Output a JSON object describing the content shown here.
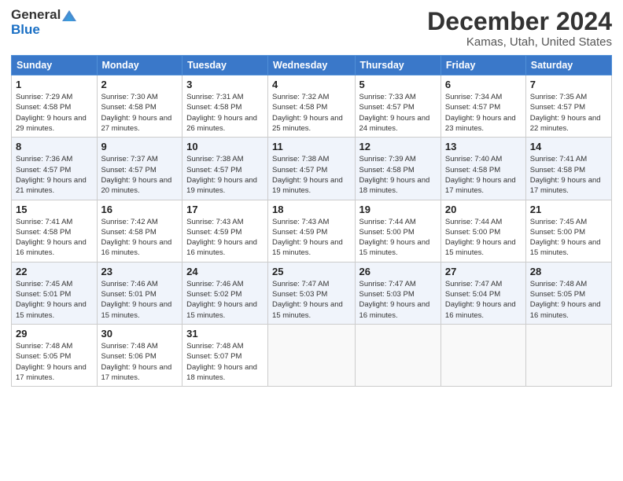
{
  "logo": {
    "general": "General",
    "blue": "Blue"
  },
  "title": "December 2024",
  "location": "Kamas, Utah, United States",
  "days_header": [
    "Sunday",
    "Monday",
    "Tuesday",
    "Wednesday",
    "Thursday",
    "Friday",
    "Saturday"
  ],
  "weeks": [
    [
      {
        "day": "1",
        "sunrise": "7:29 AM",
        "sunset": "4:58 PM",
        "daylight": "9 hours and 29 minutes."
      },
      {
        "day": "2",
        "sunrise": "7:30 AM",
        "sunset": "4:58 PM",
        "daylight": "9 hours and 27 minutes."
      },
      {
        "day": "3",
        "sunrise": "7:31 AM",
        "sunset": "4:58 PM",
        "daylight": "9 hours and 26 minutes."
      },
      {
        "day": "4",
        "sunrise": "7:32 AM",
        "sunset": "4:58 PM",
        "daylight": "9 hours and 25 minutes."
      },
      {
        "day": "5",
        "sunrise": "7:33 AM",
        "sunset": "4:57 PM",
        "daylight": "9 hours and 24 minutes."
      },
      {
        "day": "6",
        "sunrise": "7:34 AM",
        "sunset": "4:57 PM",
        "daylight": "9 hours and 23 minutes."
      },
      {
        "day": "7",
        "sunrise": "7:35 AM",
        "sunset": "4:57 PM",
        "daylight": "9 hours and 22 minutes."
      }
    ],
    [
      {
        "day": "8",
        "sunrise": "7:36 AM",
        "sunset": "4:57 PM",
        "daylight": "9 hours and 21 minutes."
      },
      {
        "day": "9",
        "sunrise": "7:37 AM",
        "sunset": "4:57 PM",
        "daylight": "9 hours and 20 minutes."
      },
      {
        "day": "10",
        "sunrise": "7:38 AM",
        "sunset": "4:57 PM",
        "daylight": "9 hours and 19 minutes."
      },
      {
        "day": "11",
        "sunrise": "7:38 AM",
        "sunset": "4:57 PM",
        "daylight": "9 hours and 19 minutes."
      },
      {
        "day": "12",
        "sunrise": "7:39 AM",
        "sunset": "4:58 PM",
        "daylight": "9 hours and 18 minutes."
      },
      {
        "day": "13",
        "sunrise": "7:40 AM",
        "sunset": "4:58 PM",
        "daylight": "9 hours and 17 minutes."
      },
      {
        "day": "14",
        "sunrise": "7:41 AM",
        "sunset": "4:58 PM",
        "daylight": "9 hours and 17 minutes."
      }
    ],
    [
      {
        "day": "15",
        "sunrise": "7:41 AM",
        "sunset": "4:58 PM",
        "daylight": "9 hours and 16 minutes."
      },
      {
        "day": "16",
        "sunrise": "7:42 AM",
        "sunset": "4:58 PM",
        "daylight": "9 hours and 16 minutes."
      },
      {
        "day": "17",
        "sunrise": "7:43 AM",
        "sunset": "4:59 PM",
        "daylight": "9 hours and 16 minutes."
      },
      {
        "day": "18",
        "sunrise": "7:43 AM",
        "sunset": "4:59 PM",
        "daylight": "9 hours and 15 minutes."
      },
      {
        "day": "19",
        "sunrise": "7:44 AM",
        "sunset": "5:00 PM",
        "daylight": "9 hours and 15 minutes."
      },
      {
        "day": "20",
        "sunrise": "7:44 AM",
        "sunset": "5:00 PM",
        "daylight": "9 hours and 15 minutes."
      },
      {
        "day": "21",
        "sunrise": "7:45 AM",
        "sunset": "5:00 PM",
        "daylight": "9 hours and 15 minutes."
      }
    ],
    [
      {
        "day": "22",
        "sunrise": "7:45 AM",
        "sunset": "5:01 PM",
        "daylight": "9 hours and 15 minutes."
      },
      {
        "day": "23",
        "sunrise": "7:46 AM",
        "sunset": "5:01 PM",
        "daylight": "9 hours and 15 minutes."
      },
      {
        "day": "24",
        "sunrise": "7:46 AM",
        "sunset": "5:02 PM",
        "daylight": "9 hours and 15 minutes."
      },
      {
        "day": "25",
        "sunrise": "7:47 AM",
        "sunset": "5:03 PM",
        "daylight": "9 hours and 15 minutes."
      },
      {
        "day": "26",
        "sunrise": "7:47 AM",
        "sunset": "5:03 PM",
        "daylight": "9 hours and 16 minutes."
      },
      {
        "day": "27",
        "sunrise": "7:47 AM",
        "sunset": "5:04 PM",
        "daylight": "9 hours and 16 minutes."
      },
      {
        "day": "28",
        "sunrise": "7:48 AM",
        "sunset": "5:05 PM",
        "daylight": "9 hours and 16 minutes."
      }
    ],
    [
      {
        "day": "29",
        "sunrise": "7:48 AM",
        "sunset": "5:05 PM",
        "daylight": "9 hours and 17 minutes."
      },
      {
        "day": "30",
        "sunrise": "7:48 AM",
        "sunset": "5:06 PM",
        "daylight": "9 hours and 17 minutes."
      },
      {
        "day": "31",
        "sunrise": "7:48 AM",
        "sunset": "5:07 PM",
        "daylight": "9 hours and 18 minutes."
      },
      null,
      null,
      null,
      null
    ]
  ]
}
